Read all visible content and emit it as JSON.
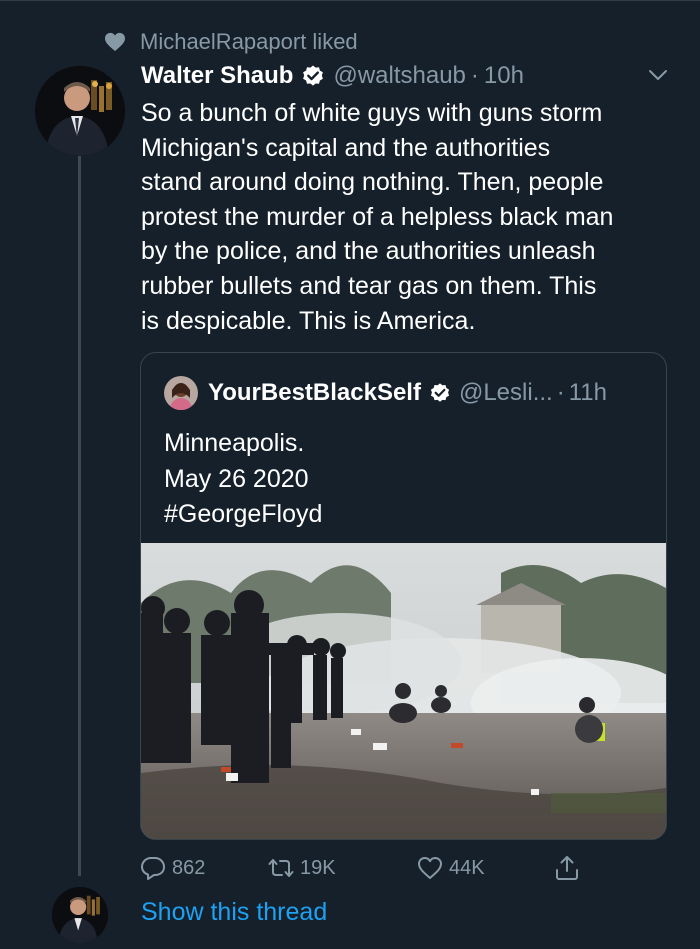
{
  "social_context": {
    "text": "MichaelRapaport liked",
    "icon": "heart-icon"
  },
  "tweet": {
    "name": "Walter Shaub",
    "handle": "@waltshaub",
    "separator": "·",
    "time": "10h",
    "text": "So a bunch of white guys with guns storm\nMichigan's capital and the authorities\nstand around doing nothing. Then, people\nprotest the murder of a helpless black man\nby the police, and the authorities unleash\nrubber bullets and tear gas on them. This\nis despicable. This is America."
  },
  "quoted_tweet": {
    "name": "YourBestBlackSelf",
    "handle": "@Lesli...",
    "separator": "·",
    "time": "11h",
    "text": "Minneapolis.\nMay 26 2020\n#GeorgeFloyd"
  },
  "actions": {
    "replies": "862",
    "retweets": "19K",
    "likes": "44K"
  },
  "show_thread": "Show this thread",
  "colors": {
    "background": "#15202b",
    "secondary_text": "#8899a6",
    "link": "#1da1f2",
    "border": "#38444d"
  }
}
